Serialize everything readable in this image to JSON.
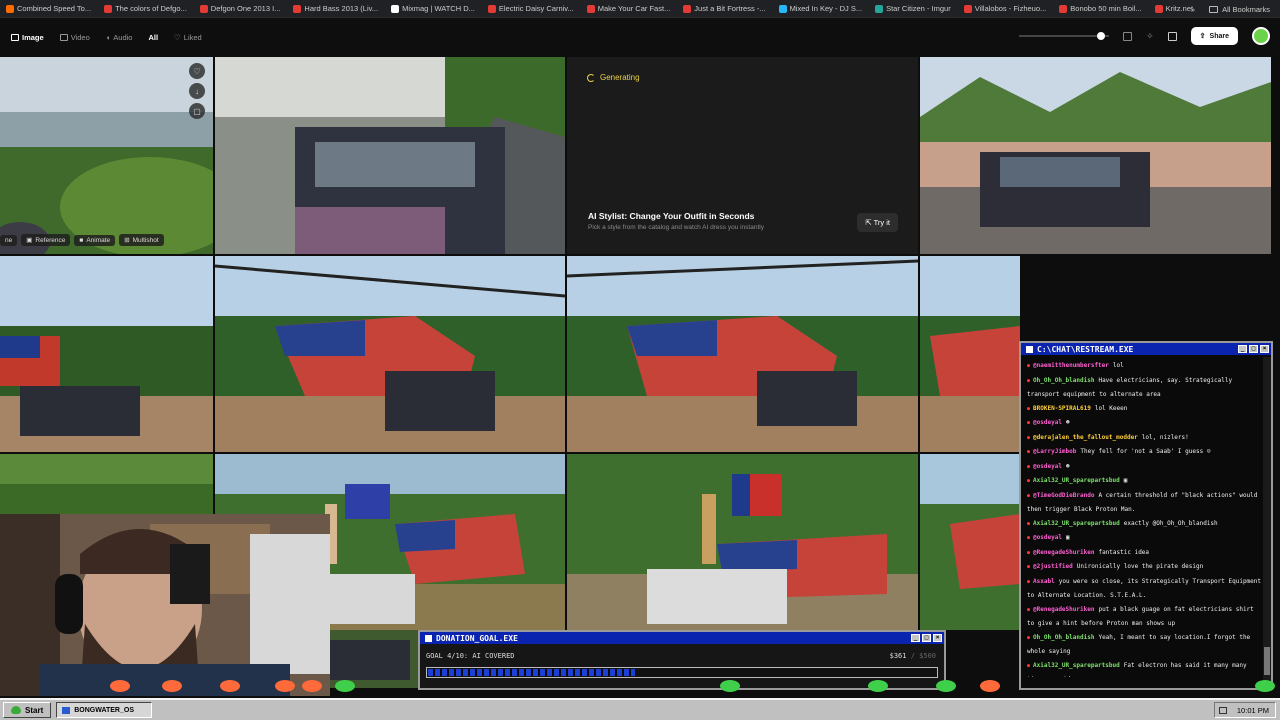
{
  "bookmarks": [
    {
      "label": "Combined Speed To...",
      "color": "#ff6d00"
    },
    {
      "label": "The colors of Defgo...",
      "color": "#e53935"
    },
    {
      "label": "Defgon One 2013 I...",
      "color": "#e53935"
    },
    {
      "label": "Hard Bass 2013 (Liv...",
      "color": "#e53935"
    },
    {
      "label": "Mixmag | WATCH D...",
      "color": "#ffffff"
    },
    {
      "label": "Electric Daisy Carniv...",
      "color": "#e53935"
    },
    {
      "label": "Make Your Car Fast...",
      "color": "#e53935"
    },
    {
      "label": "Just a Bit Fortress -...",
      "color": "#e53935"
    },
    {
      "label": "Mixed In Key - DJ S...",
      "color": "#29b6f6"
    },
    {
      "label": "Star Citizen - Imgur",
      "color": "#26a69a"
    },
    {
      "label": "Villalobos - Fizheuo...",
      "color": "#e53935"
    },
    {
      "label": "Bonobo 50 min Boil...",
      "color": "#e53935"
    },
    {
      "label": "Kritz.net",
      "color": "#e53935"
    }
  ],
  "bookmarks_more": "»",
  "all_bookmarks": "All Bookmarks",
  "filters": [
    {
      "label": "Image",
      "active": true
    },
    {
      "label": "Video",
      "active": false
    },
    {
      "label": "Audio",
      "active": false
    },
    {
      "label": "All",
      "active": true
    },
    {
      "label": "Liked",
      "active": false
    }
  ],
  "share_label": "Share",
  "generating_label": "Generating",
  "promo": {
    "title": "AI Stylist: Change Your Outfit in Seconds",
    "subtitle": "Pick a style from the catalog and watch AI dress you instantly",
    "button": "Try it"
  },
  "tile_actions": [
    "ne",
    "Reference",
    "Animate",
    "Multishot"
  ],
  "chat": {
    "title": "C:\\CHAT\\RESTREAM.EXE",
    "messages": [
      {
        "user": "@naemitthenumbersfter",
        "color": "#ff5fd2",
        "text": "lol"
      },
      {
        "user": "Oh_Oh_Oh_blandish",
        "color": "#7ee06e",
        "text": "Have electricians, say. Strategically transport equipment to alternate area"
      },
      {
        "user": "BROKEN-SPIRAL619",
        "color": "#ffcf3a",
        "text": "lol Keeen"
      },
      {
        "user": "@osdeyal",
        "color": "#ff5fd2",
        "text": "☻"
      },
      {
        "user": "@derajalen_the_fallout_modder",
        "color": "#ffcf3a",
        "text": "lol, nizlers!"
      },
      {
        "user": "@LarryJimbob",
        "color": "#ff5fd2",
        "text": "They fell for 'not a Saab' I guess ☺"
      },
      {
        "user": "@osdeyal",
        "color": "#ff5fd2",
        "text": "☻"
      },
      {
        "user": "Axial32_UR_sparepartsbud",
        "color": "#7ee06e",
        "text": "▣"
      },
      {
        "user": "@TimeGodDieBrando",
        "color": "#ff5fd2",
        "text": "A certain threshold of \"black actions\" would then trigger Black Proton Man."
      },
      {
        "user": "Axial32_UR_sparepartsbud",
        "color": "#7ee06e",
        "text": "exactly @Oh_Oh_Oh_blandish"
      },
      {
        "user": "@osdeyal",
        "color": "#ff5fd2",
        "text": "▣"
      },
      {
        "user": "@RenegadeShuriken",
        "color": "#ff5fd2",
        "text": "fantastic idea"
      },
      {
        "user": "@2justified",
        "color": "#ff5fd2",
        "text": "Unironically love the pirate design"
      },
      {
        "user": "Asxabl",
        "color": "#ff5fd2",
        "text": "you were so close, its Strategically Transport Equipment to Alternate Location. S.T.E.A.L."
      },
      {
        "user": "@RenegadeShuriken",
        "color": "#ff5fd2",
        "text": "put a black guage on fat electricians shirt to give a hint before Proton man shows up"
      },
      {
        "user": "Oh_Oh_Oh_blandish",
        "color": "#7ee06e",
        "text": "Yeah, I meant to say location.I forgot the whole saying"
      },
      {
        "user": "Axial32_UR_sparepartsbud",
        "color": "#7ee06e",
        "text": "Fat electron has said it many many times on videos"
      }
    ]
  },
  "donation": {
    "title": "DONATION_GOAL.EXE",
    "goal_text": "GOAL 4/10: AI COVERED",
    "current": "$361",
    "max": "/ $500",
    "progress": 0.41
  },
  "taskbar": {
    "start_label": "Start",
    "window_label": "BONGWATER_OS",
    "clock": "10:01 PM"
  }
}
